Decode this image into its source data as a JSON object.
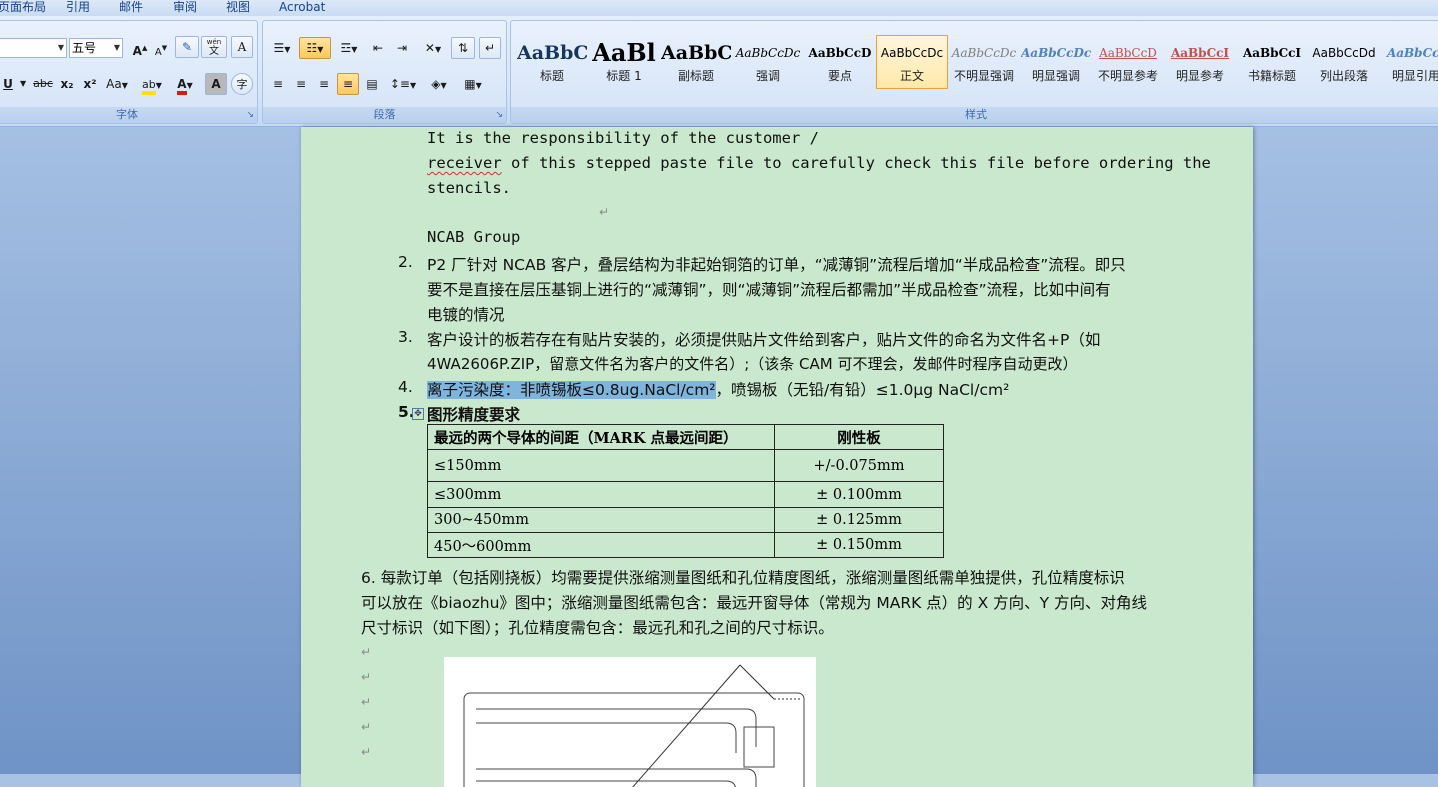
{
  "ribbon_tabs": [
    "页面布局",
    "引用",
    "邮件",
    "审阅",
    "视图",
    "Acrobat"
  ],
  "font_group": {
    "label": "字体",
    "font_name": "",
    "font_size": "五号",
    "grow_label": "A",
    "shrink_label": "A",
    "change_case_label": "Aa",
    "highlight_label": "ab",
    "font_color_label": "A",
    "char_shade_label": "A",
    "enclose_label": "字",
    "phonetic_label": "wén",
    "phonetic_char": "文",
    "border_label": "A",
    "underline_label": "U",
    "strike_label": "abc",
    "subscript_label": "x₂",
    "superscript_label": "x²"
  },
  "paragraph_group": {
    "label": "段落"
  },
  "styles_group": {
    "label": "样式",
    "items": [
      {
        "sample": "AaBbC",
        "name": "标题"
      },
      {
        "sample": "AaBl",
        "name": "标题 1"
      },
      {
        "sample": "AaBbC",
        "name": "副标题"
      },
      {
        "sample": "AaBbCcDc",
        "name": "强调"
      },
      {
        "sample": "AaBbCcD",
        "name": "要点"
      },
      {
        "sample": "AaBbCcDc",
        "name": "正文"
      },
      {
        "sample": "AaBbCcDc",
        "name": "不明显强调"
      },
      {
        "sample": "AaBbCcDc",
        "name": "明显强调"
      },
      {
        "sample": "AaBbCcD",
        "name": "不明显参考"
      },
      {
        "sample": "AaBbCcI",
        "name": "明显参考"
      },
      {
        "sample": "AaBbCcI",
        "name": "书籍标题"
      },
      {
        "sample": "AaBbCcDd",
        "name": "列出段落"
      },
      {
        "sample": "AaBbCcI",
        "name": "明显引用"
      }
    ],
    "colors": {
      "active_border": "#e6a33a",
      "accent": "#3e6aaa"
    }
  },
  "document": {
    "line1": "It is the responsibility of the customer /",
    "line2_word": "receiver",
    "line2_rest": " of this stepped paste file to carefully check this file before ordering the",
    "line3": "stencils.",
    "company": "NCAB Group",
    "item2_num": "2.",
    "item2_l1": "P2 厂针对 NCAB 客户，叠层结构为非起始铜箔的订单，“减薄铜”流程后增加“半成品检查”流程。即只",
    "item2_l2": "要不是直接在层压基铜上进行的“减薄铜”，则“减薄铜”流程后都需加”半成品检查”流程，比如中间有",
    "item2_l3": "电镀的情况",
    "item3_num": "3.",
    "item3_l1": "客户设计的板若存在有贴片安装的，必须提供贴片文件给到客户，贴片文件的命名为文件名+P（如",
    "item3_l2": "4WA2606P.ZIP，留意文件名为客户的文件名）;（该条 CAM 可不理会，发邮件时程序自动更改）",
    "item4_num": "4.",
    "item4_highlight": "离子污染度：非喷锡板≤0.8ug.NaCl/cm²",
    "item4_rest": "，喷锡板（无铅/有铅）≤1.0μg NaCl/cm²",
    "item5_num": "5.",
    "item5_title": "图形精度要求",
    "table": {
      "headers": [
        "最远的两个导体的间距（MARK 点最远间距）",
        "刚性板"
      ],
      "rows": [
        [
          "≤150mm",
          "+/-0.075mm"
        ],
        [
          "≤300mm",
          "± 0.100mm"
        ],
        [
          "300~450mm",
          "± 0.125mm"
        ],
        [
          "450～600mm",
          "± 0.150mm"
        ]
      ]
    },
    "item6_l1": "6. 每款订单（包括刚挠板）均需要提供涨缩测量图纸和孔位精度图纸，涨缩测量图纸需单独提供，孔位精度标识",
    "item6_l2": "可以放在《biaozhu》图中；涨缩测量图纸需包含：最远开窗导体（常规为 MARK 点）的 X 方向、Y 方向、对角线",
    "item6_l3": "尺寸标识（如下图）；孔位精度需包含：最远孔和孔之间的尺寸标识。"
  }
}
